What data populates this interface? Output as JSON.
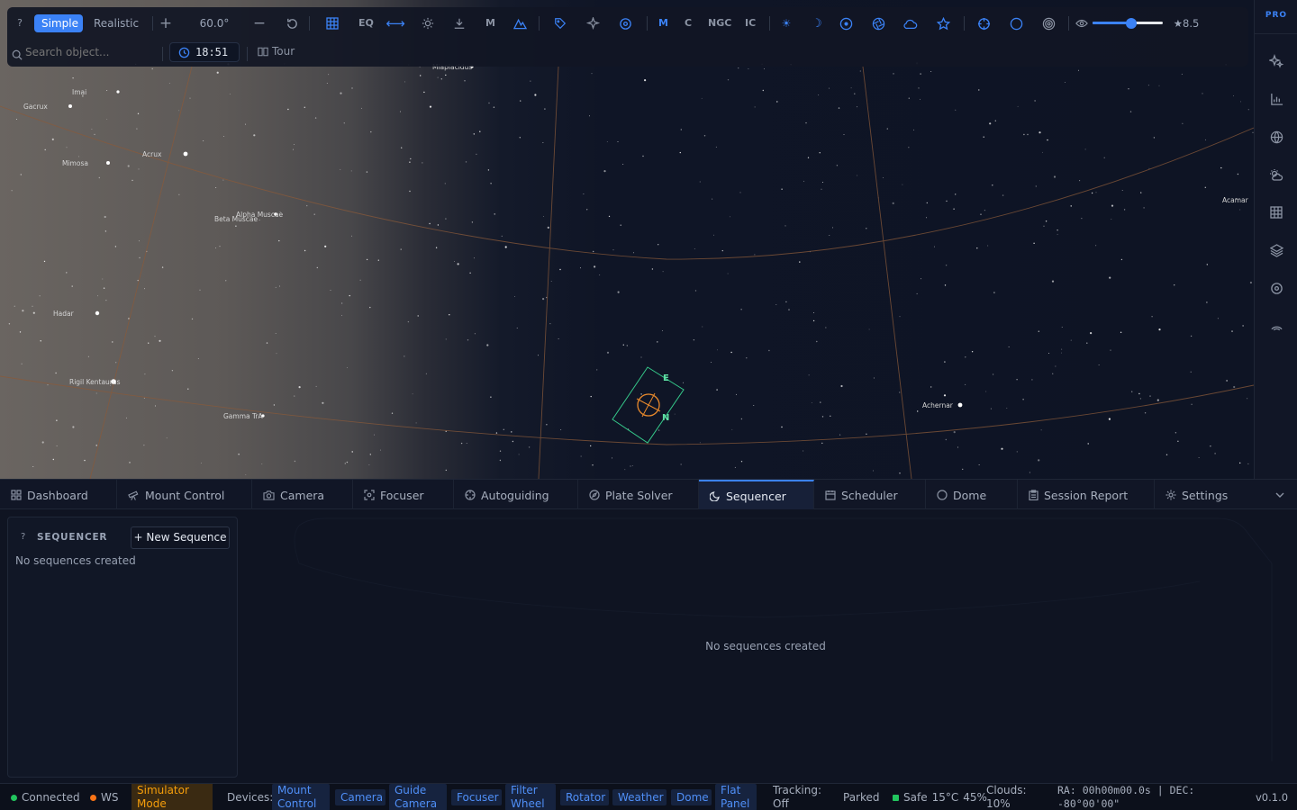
{
  "toolbar": {
    "help": "?",
    "simple": "Simple",
    "realistic": "Realistic",
    "fov": "60.0°",
    "eq": "EQ",
    "m_small": "M",
    "catalog_m": "M",
    "catalog_c": "C",
    "catalog_ngc": "NGC",
    "catalog_ic": "IC",
    "magnitude": "★8.5",
    "magnitude_slider_fraction": 0.55,
    "search_placeholder": "Search object...",
    "time": "18:51",
    "tour": "Tour",
    "accent": "#3b82f6"
  },
  "sidebar": {
    "pro": "PRO"
  },
  "sky": {
    "labels": {
      "imai": "Imai",
      "gacrux": "Gacrux",
      "acrux": "Acrux",
      "mimosa": "Mimosa",
      "alpha_muscae": "Alpha Muscae",
      "beta_muscae": "Beta Muscae",
      "hadar": "Hadar",
      "rigil": "Rigil Kentaurus",
      "gamma_tra": "Gamma TrA",
      "achernar": "Achernar",
      "acamar": "Acamar",
      "top": "Miaplacidus",
      "fov_e": "E",
      "fov_n": "N"
    }
  },
  "tabs": [
    {
      "label": "Dashboard",
      "icon": "dashboard-icon"
    },
    {
      "label": "Mount Control",
      "icon": "telescope-icon"
    },
    {
      "label": "Camera",
      "icon": "camera-icon"
    },
    {
      "label": "Focuser",
      "icon": "focus-icon"
    },
    {
      "label": "Autoguiding",
      "icon": "crosshair-icon"
    },
    {
      "label": "Plate Solver",
      "icon": "compass-icon"
    },
    {
      "label": "Sequencer",
      "icon": "moon-icon"
    },
    {
      "label": "Scheduler",
      "icon": "calendar-icon"
    },
    {
      "label": "Dome",
      "icon": "circle-icon"
    },
    {
      "label": "Session Report",
      "icon": "clipboard-icon"
    },
    {
      "label": "Settings",
      "icon": "gear-icon"
    }
  ],
  "sequencer": {
    "help": "?",
    "title": "SEQUENCER",
    "new_button": "+ New Sequence",
    "empty_left": "No sequences created",
    "empty_main": "No sequences created"
  },
  "status": {
    "connected": "Connected",
    "ws": "WS",
    "simulator_line1": "Simulator",
    "simulator_line2": "Mode",
    "devices_label": "Devices:",
    "devices": [
      {
        "l1": "Mount",
        "l2": "Control"
      },
      {
        "l1": "Camera",
        "l2": ""
      },
      {
        "l1": "Guide",
        "l2": "Camera"
      },
      {
        "l1": "Focuser",
        "l2": ""
      },
      {
        "l1": "Filter",
        "l2": "Wheel"
      },
      {
        "l1": "Rotator",
        "l2": ""
      },
      {
        "l1": "Weather",
        "l2": ""
      },
      {
        "l1": "Dome",
        "l2": ""
      },
      {
        "l1": "Flat",
        "l2": "Panel"
      }
    ],
    "tracking_l1": "Tracking:",
    "tracking_l2": "Off",
    "parked": "Parked",
    "safe": "Safe",
    "temp": "15°C",
    "humidity": "45%",
    "clouds_l1": "Clouds:",
    "clouds_l2": "10%",
    "ra_l1": "RA: 00h00m00.0s | DEC:",
    "ra_l2": "-80°00'00\"",
    "version": "v0.1.0",
    "colors": {
      "connected": "#22c55e",
      "ws": "#f97316",
      "safe": "#22c55e",
      "simulator_bg": "#3a2a12",
      "simulator_fg": "#f59e0b"
    }
  }
}
